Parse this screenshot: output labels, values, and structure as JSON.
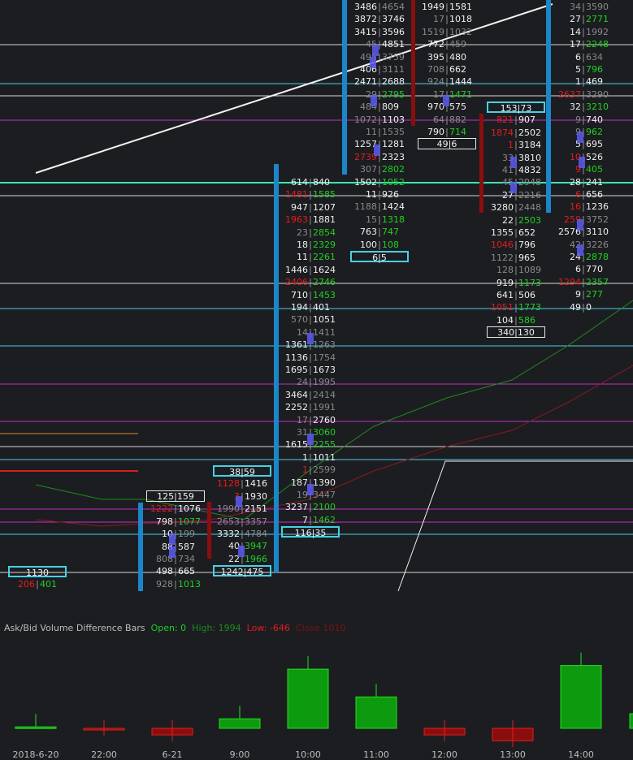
{
  "indicator": {
    "title": "Ask/Bid Volume Difference Bars",
    "open_label": "Open: 0",
    "high_label": "High: 1994",
    "low_label": "Low: -646",
    "close_label": "Close 1010"
  },
  "time_axis": [
    "2018-6-20",
    "22:00",
    "6-21",
    "9:00",
    "10:00",
    "11:00",
    "12:00",
    "13:00",
    "14:00"
  ],
  "columns": [
    {
      "id": "c0",
      "cells": [
        [
          "1130",
          "",
          ""
        ],
        [
          "206",
          "401",
          "rg"
        ]
      ]
    },
    {
      "id": "c1",
      "cells": [
        [
          "125",
          "159",
          "box"
        ],
        [
          "1222",
          "1076",
          "rw"
        ],
        [
          "798",
          "1077",
          "wg"
        ],
        [
          "10",
          "199",
          "wgr"
        ],
        [
          "88",
          "587",
          "ww"
        ],
        [
          "808",
          "734",
          "grgr"
        ],
        [
          "498",
          "665",
          "ww"
        ],
        [
          "928",
          "1013",
          "grg"
        ]
      ]
    },
    {
      "id": "c2",
      "cells": [
        [
          "38",
          "59",
          "box"
        ],
        [
          "1128",
          "1416",
          "rw"
        ],
        [
          "3",
          "1930",
          "rw"
        ],
        [
          "1990",
          "2151",
          "grw"
        ],
        [
          "2653",
          "3357",
          "grgr"
        ],
        [
          "3332",
          "4784",
          "wgr"
        ],
        [
          "40",
          "3947",
          "wg"
        ],
        [
          "22",
          "1966",
          "wg"
        ],
        [
          "1242",
          "475",
          "box"
        ]
      ]
    },
    {
      "id": "c3",
      "cells": [
        [
          "614",
          "840",
          "ww"
        ],
        [
          "1481",
          "1585",
          "rg"
        ],
        [
          "947",
          "1207",
          "ww"
        ],
        [
          "1963",
          "1881",
          "rw"
        ],
        [
          "23",
          "2854",
          "grg"
        ],
        [
          "18",
          "2329",
          "wg"
        ],
        [
          "11",
          "2261",
          "wg"
        ],
        [
          "1446",
          "1624",
          "ww"
        ],
        [
          "2406",
          "2746",
          "rg"
        ],
        [
          "710",
          "1453",
          "wg"
        ],
        [
          "194",
          "401",
          "ww"
        ],
        [
          "570",
          "1051",
          "grw"
        ],
        [
          "14",
          "1411",
          "grgr"
        ],
        [
          "1361",
          "1263",
          "wgr"
        ],
        [
          "1136",
          "1754",
          "wgr"
        ],
        [
          "1695",
          "1673",
          "ww"
        ],
        [
          "24",
          "1995",
          "grgr"
        ],
        [
          "3464",
          "2414",
          "wgr"
        ],
        [
          "2252",
          "1991",
          "wgr"
        ],
        [
          "17",
          "2760",
          "grw"
        ],
        [
          "31",
          "3060",
          "grg"
        ],
        [
          "1615",
          "2255",
          "wg"
        ],
        [
          "1",
          "1011",
          "ww"
        ],
        [
          "1",
          "2599",
          "rgr"
        ],
        [
          "187",
          "1390",
          "ww"
        ],
        [
          "19",
          "3447",
          "grgr"
        ],
        [
          "3237",
          "2100",
          "wg"
        ],
        [
          "7",
          "1462",
          "wg"
        ],
        [
          "116",
          "35",
          "box"
        ]
      ]
    },
    {
      "id": "c4",
      "cells": [
        [
          "3486",
          "4654",
          "wgr"
        ],
        [
          "3872",
          "3746",
          "ww"
        ],
        [
          "3415",
          "3596",
          "ww"
        ],
        [
          "45",
          "4851",
          "grw"
        ],
        [
          "495",
          "3759",
          "grgr"
        ],
        [
          "406",
          "3111",
          "wgr"
        ],
        [
          "2471",
          "2688",
          "ww"
        ],
        [
          "29",
          "2795",
          "grg"
        ],
        [
          "484",
          "809",
          "grw"
        ],
        [
          "1072",
          "1103",
          "grw"
        ],
        [
          "11",
          "1535",
          "grgr"
        ],
        [
          "1257",
          "1281",
          "ww"
        ],
        [
          "2739",
          "2323",
          "rw"
        ],
        [
          "307",
          "2802",
          "grg"
        ],
        [
          "1502",
          "1052",
          "wg"
        ],
        [
          "11",
          "926",
          "ww"
        ],
        [
          "1188",
          "1424",
          "grw"
        ],
        [
          "15",
          "1318",
          "grg"
        ],
        [
          "763",
          "747",
          "wg"
        ],
        [
          "100",
          "108",
          "wg"
        ],
        [
          "6",
          "5",
          "box"
        ]
      ]
    },
    {
      "id": "c5",
      "cells": [
        [
          "1949",
          "1581",
          "ww"
        ],
        [
          "17",
          "1018",
          "grw"
        ],
        [
          "1519",
          "1032",
          "grgr"
        ],
        [
          "772",
          "459",
          "wgr"
        ],
        [
          "395",
          "480",
          "ww"
        ],
        [
          "708",
          "662",
          "grw"
        ],
        [
          "924",
          "1444",
          "grw"
        ],
        [
          "17",
          "1471",
          "grg"
        ],
        [
          "970",
          "575",
          "ww"
        ],
        [
          "64",
          "882",
          "grgr"
        ],
        [
          "790",
          "714",
          "wg"
        ],
        [
          "49",
          "6",
          "box"
        ]
      ]
    },
    {
      "id": "c6",
      "cells": [
        [
          "153",
          "73",
          "box"
        ],
        [
          "821",
          "907",
          "rw"
        ],
        [
          "1874",
          "2502",
          "rw"
        ],
        [
          "1",
          "3184",
          "rw"
        ],
        [
          "33",
          "3810",
          "grw"
        ],
        [
          "41",
          "4832",
          "grw"
        ],
        [
          "45",
          "2948",
          "grgr"
        ],
        [
          "27",
          "2216",
          "wgr"
        ],
        [
          "3280",
          "2448",
          "wgr"
        ],
        [
          "22",
          "2503",
          "wg"
        ],
        [
          "1355",
          "652",
          "ww"
        ],
        [
          "1046",
          "796",
          "rw"
        ],
        [
          "1122",
          "965",
          "grw"
        ],
        [
          "128",
          "1089",
          "grgr"
        ],
        [
          "919",
          "1173",
          "wg"
        ],
        [
          "641",
          "506",
          "ww"
        ],
        [
          "1051",
          "1773",
          "rg"
        ],
        [
          "104",
          "586",
          "wg"
        ],
        [
          "340",
          "130",
          "box"
        ]
      ]
    },
    {
      "id": "c7",
      "cells": [
        [
          "34",
          "3590",
          "grgr"
        ],
        [
          "27",
          "2771",
          "wg"
        ],
        [
          "14",
          "1992",
          "wgr"
        ],
        [
          "17",
          "2248",
          "wg"
        ],
        [
          "6",
          "634",
          "wgr"
        ],
        [
          "5",
          "796",
          "wg"
        ],
        [
          "1",
          "469",
          "ww"
        ],
        [
          "2637",
          "3290",
          "rgr"
        ],
        [
          "32",
          "3210",
          "wg"
        ],
        [
          "9",
          "740",
          "grw"
        ],
        [
          "9",
          "962",
          "grg"
        ],
        [
          "5",
          "695",
          "ww"
        ],
        [
          "10",
          "526",
          "rw"
        ],
        [
          "9",
          "405",
          "rg"
        ],
        [
          "28",
          "241",
          "ww"
        ],
        [
          "6",
          "656",
          "rw"
        ],
        [
          "16",
          "1236",
          "rw"
        ],
        [
          "259",
          "3752",
          "rgr"
        ],
        [
          "2576",
          "3110",
          "ww"
        ],
        [
          "42",
          "3226",
          "grgr"
        ],
        [
          "24",
          "2878",
          "wg"
        ],
        [
          "6",
          "770",
          "ww"
        ],
        [
          "1294",
          "2357",
          "rg"
        ],
        [
          "9",
          "277",
          "wg"
        ],
        [
          "49",
          "0",
          "ww"
        ]
      ]
    }
  ],
  "colors": {
    "bg": "#1c1d21",
    "ask_up": "#21d021",
    "bid_down": "#e51c1c",
    "cyan": "#47d0e6",
    "magenta": "#c42fc4",
    "blue_profile": "#1c86c8",
    "poc": "#5c5cf0"
  },
  "bars": [
    {
      "label": "2018-6-20",
      "open": 0,
      "close": 20
    },
    {
      "label": "22:00",
      "open": 0,
      "close": -10
    },
    {
      "label": "6-21",
      "open": 0,
      "close": -90
    },
    {
      "label": "9:00",
      "open": 0,
      "close": 130
    },
    {
      "label": "10:00",
      "open": 0,
      "close": 810
    },
    {
      "label": "11:00",
      "open": 0,
      "close": 430
    },
    {
      "label": "12:00",
      "open": 0,
      "close": -90
    },
    {
      "label": "13:00",
      "open": 0,
      "close": -170
    },
    {
      "label": "14:00",
      "open": 0,
      "close": 860
    }
  ]
}
